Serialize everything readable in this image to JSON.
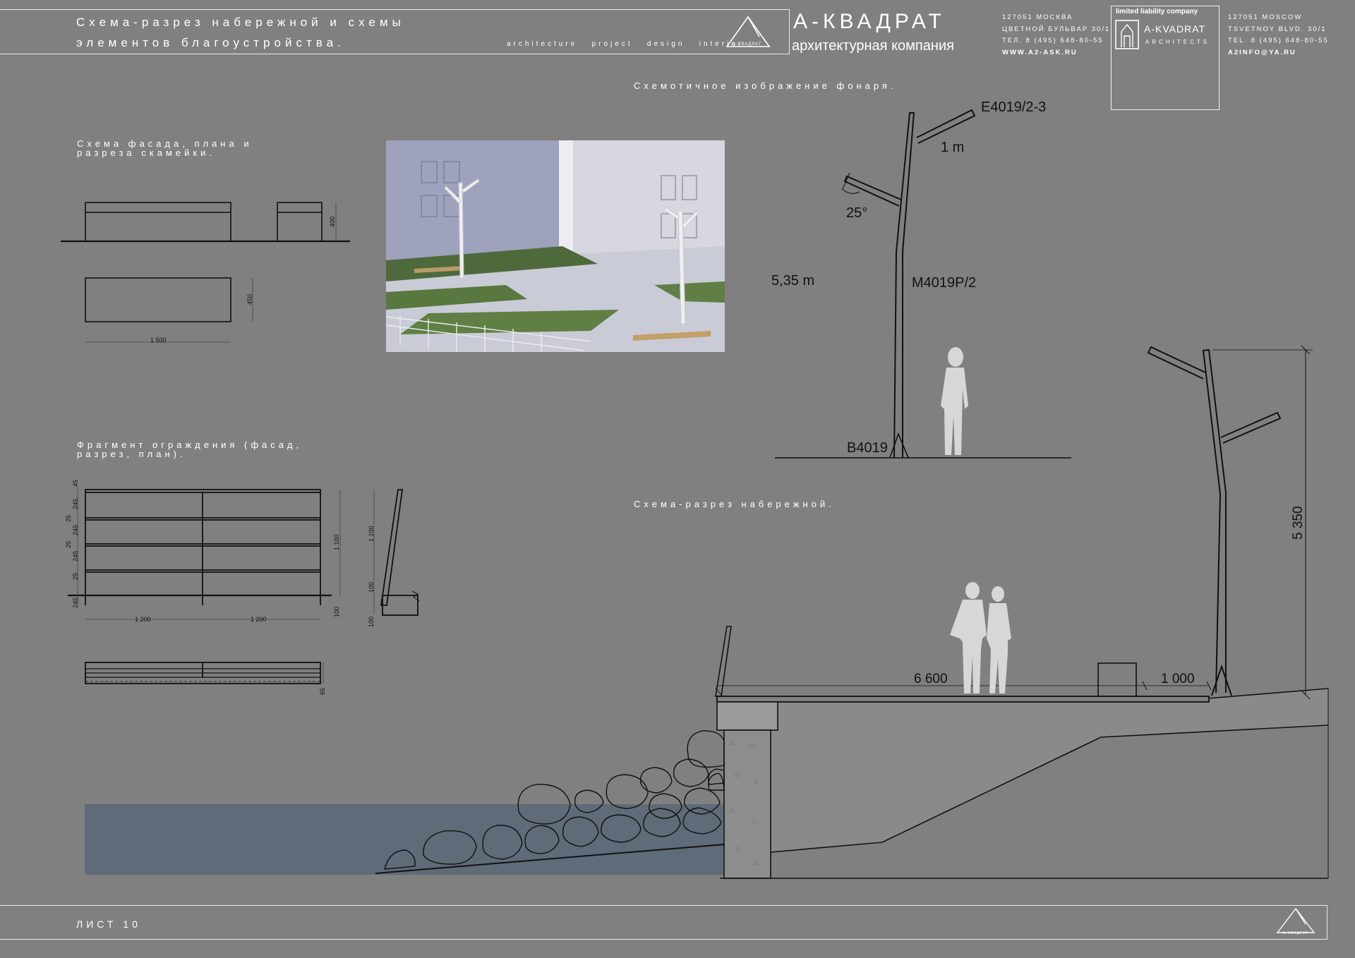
{
  "header": {
    "title_line1": "Схема-разрез набережной и схемы",
    "title_line2": "элементов благоустройства.",
    "disciplines": "architecture   project   design   interior",
    "logo_caption": "А-КВАДРАТ",
    "brand_name": "А-КВАДРАТ",
    "brand_subtitle": "архитектурная компания",
    "address_ru": [
      "127051 МОСКВА",
      "ЦВЕТНОЙ БУЛЬВАР 30/1",
      "ТЕЛ. 8 (495) 648-80-55",
      "WWW.A2-ASK.RU"
    ],
    "company_type": "limited liability company",
    "brand_en": "A-KVADRAT",
    "brand_en_sub": "ARCHITECTS",
    "address_en": [
      "127051 MOSCOW",
      "TSVETNOY BLVD. 30/1",
      "TEL. 8 (495) 648-80-55",
      "A2INFO@YA.RU"
    ]
  },
  "sections": {
    "lamp_title": "Схемотичное изображение фонаря.",
    "bench_title_1": "Схема фасада, плана и",
    "bench_title_2": "разреза скамейки.",
    "fence_title_1": "Фрагмент ограждения (фасад,",
    "fence_title_2": "разрез, план).",
    "embankment_title": "Схема-разрез набережной."
  },
  "lamp": {
    "top_model": "E4019/2-3",
    "arm_length": "1 m",
    "angle": "25°",
    "height": "5,35 m",
    "pole_model": "M4019P/2",
    "base_model": "B4019"
  },
  "bench": {
    "height": "400",
    "depth": "450",
    "length": "1 500"
  },
  "fence": {
    "dims_left": [
      "45",
      "245",
      "25",
      "245",
      "25",
      "245",
      "25",
      "245"
    ],
    "height": "1 100",
    "bottom": "100",
    "span_1": "1 200",
    "span_2": "1 200",
    "section_height": "1 100",
    "section_100a": "100",
    "section_100b": "100",
    "plan_depth": "65"
  },
  "embankment": {
    "walkway_width": "6 600",
    "offset": "1 000",
    "lamp_height": "5 350"
  },
  "footer": {
    "sheet": "ЛИСТ 10",
    "logo_caption": "А-КВАДРАТ"
  },
  "colors": {
    "background": "#808080",
    "line": "#111111",
    "water": "#5f6b78",
    "figure": "#d7d7d7"
  }
}
